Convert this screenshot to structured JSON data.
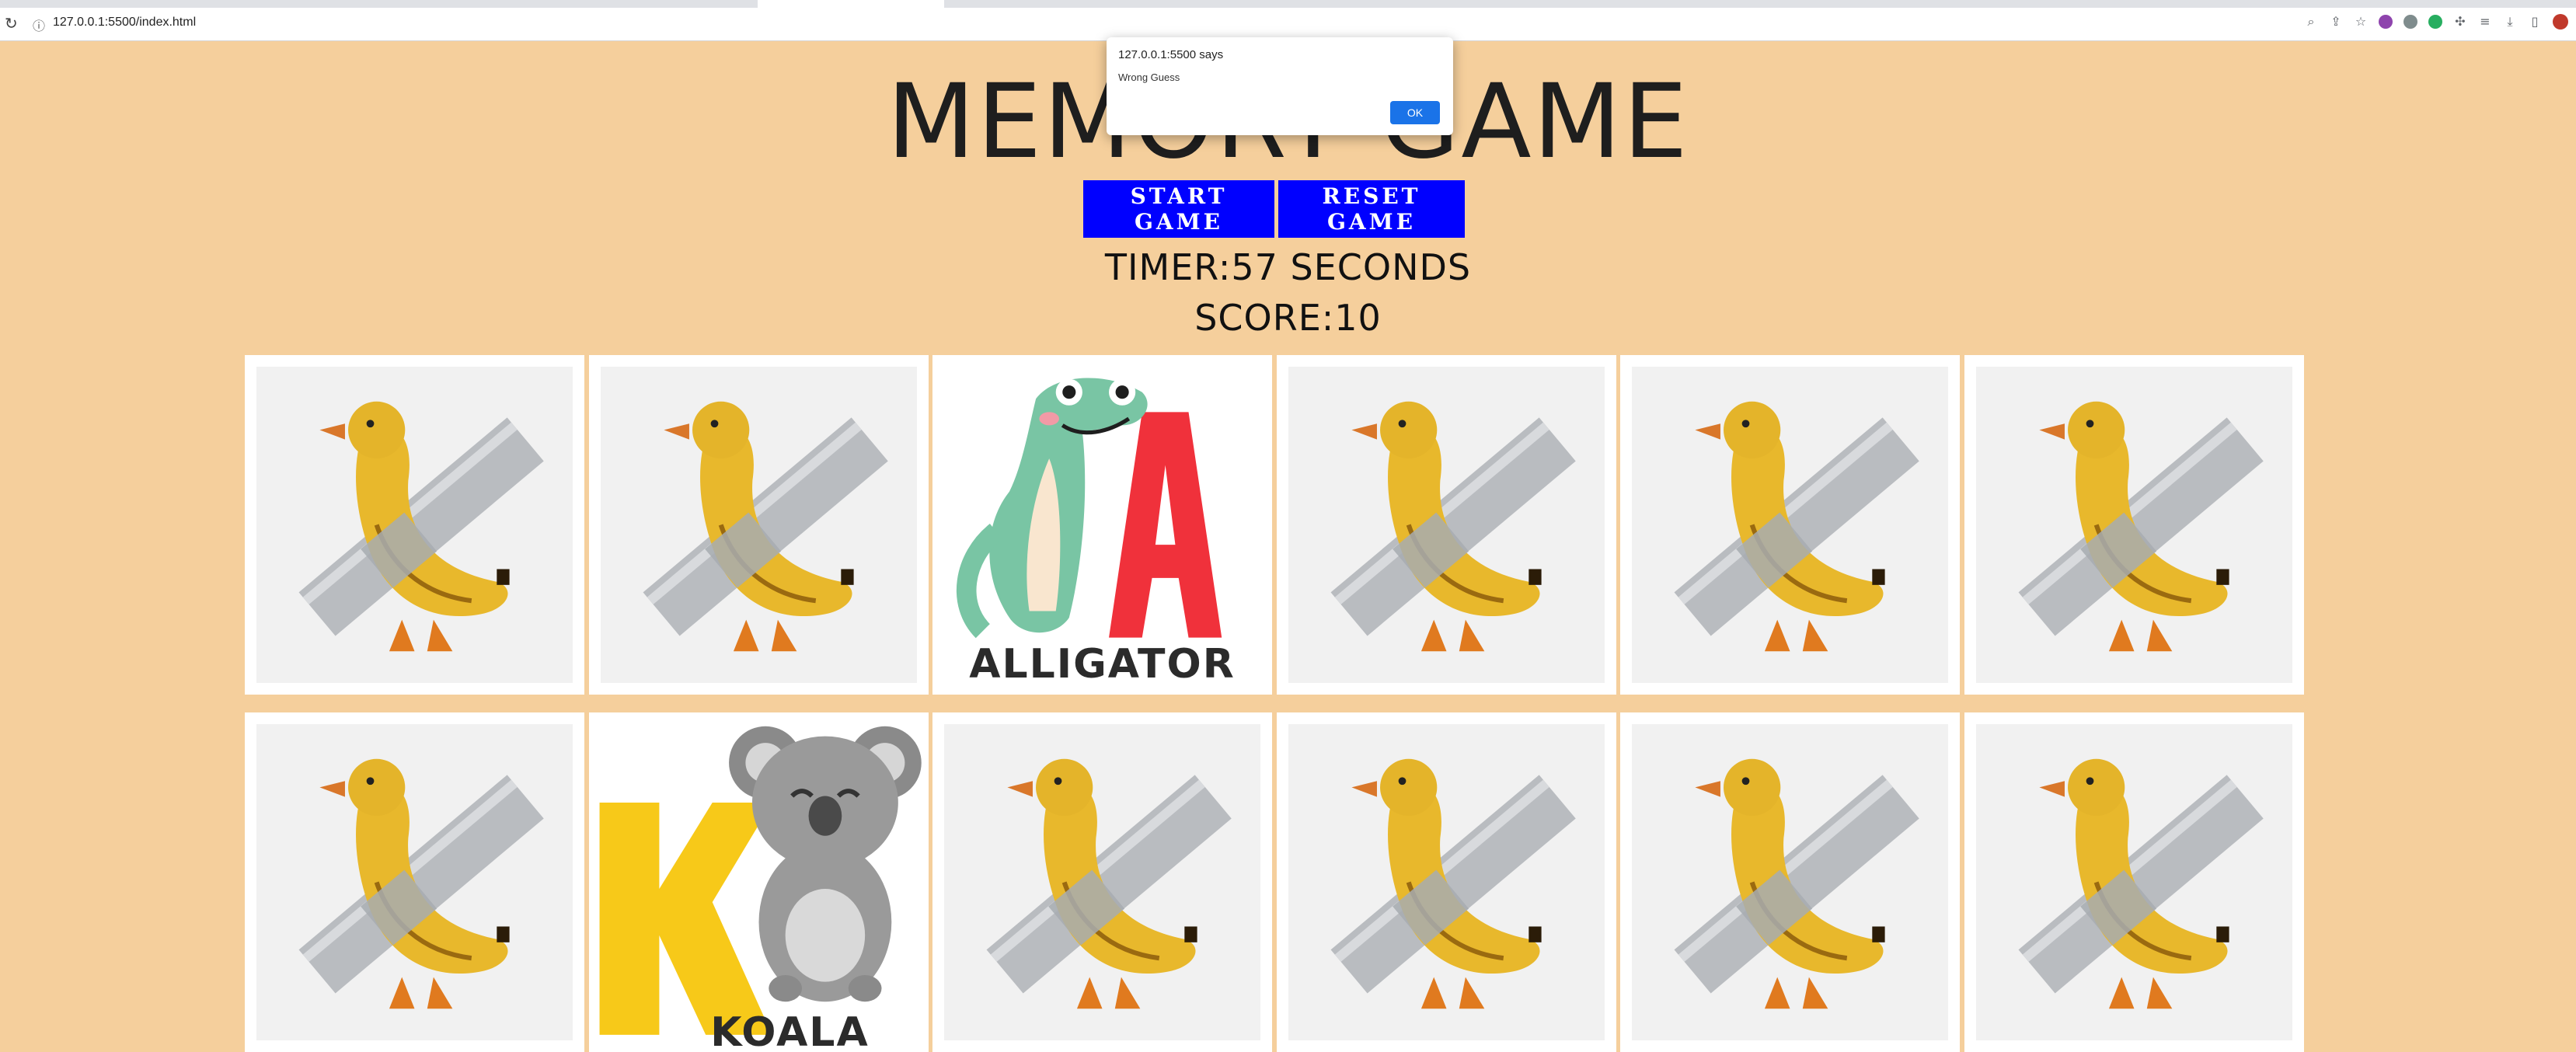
{
  "browser": {
    "url": "127.0.0.1:5500/index.html"
  },
  "page": {
    "title": "MEMORY GAME",
    "start_label": "START GAME",
    "reset_label": "RESET GAME",
    "timer_text": "TIMER:57 SECONDS",
    "score_text": "SCORE:10"
  },
  "colors": {
    "background": "#f5cf9c",
    "button": "#0000ff",
    "dialog_ok": "#1a73e8"
  },
  "cards": [
    {
      "face": "banana-duck"
    },
    {
      "face": "banana-duck"
    },
    {
      "face": "alligator",
      "label": "ALLIGATOR"
    },
    {
      "face": "banana-duck"
    },
    {
      "face": "banana-duck"
    },
    {
      "face": "banana-duck"
    },
    {
      "face": "banana-duck"
    },
    {
      "face": "koala",
      "label": "KOALA"
    },
    {
      "face": "banana-duck"
    },
    {
      "face": "banana-duck"
    },
    {
      "face": "banana-duck"
    },
    {
      "face": "banana-duck"
    }
  ],
  "dialog": {
    "title": "127.0.0.1:5500 says",
    "message": "Wrong Guess",
    "ok_label": "OK"
  }
}
